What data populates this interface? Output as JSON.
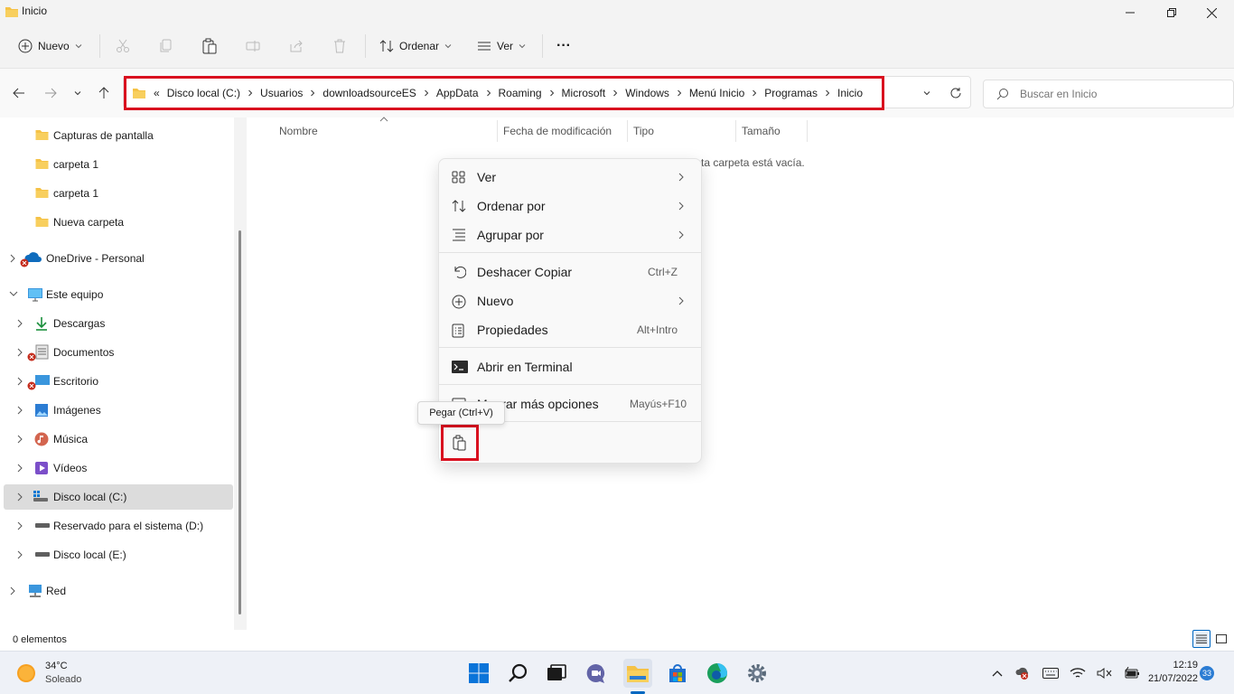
{
  "window": {
    "title": "Inicio"
  },
  "toolbar": {
    "new_label": "Nuevo",
    "sort_label": "Ordenar",
    "view_label": "Ver",
    "more_label": "···"
  },
  "address": {
    "overflow": "«",
    "crumbs": [
      "Disco local (C:)",
      "Usuarios",
      "downloadsourceES",
      "AppData",
      "Roaming",
      "Microsoft",
      "Windows",
      "Menú Inicio",
      "Programas",
      "Inicio"
    ]
  },
  "search": {
    "placeholder": "Buscar en Inicio"
  },
  "sidebar": {
    "items": [
      {
        "label": "Capturas de pantalla"
      },
      {
        "label": "carpeta 1"
      },
      {
        "label": "carpeta 1"
      },
      {
        "label": "Nueva carpeta"
      },
      {
        "label": "OneDrive - Personal"
      },
      {
        "label": "Este equipo"
      },
      {
        "label": "Descargas"
      },
      {
        "label": "Documentos"
      },
      {
        "label": "Escritorio"
      },
      {
        "label": "Imágenes"
      },
      {
        "label": "Música"
      },
      {
        "label": "Vídeos"
      },
      {
        "label": "Disco local (C:)"
      },
      {
        "label": "Reservado para el sistema (D:)"
      },
      {
        "label": "Disco local (E:)"
      },
      {
        "label": "Red"
      }
    ]
  },
  "columns": {
    "name": "Nombre",
    "modified": "Fecha de modificación",
    "type": "Tipo",
    "size": "Tamaño"
  },
  "content": {
    "empty_message": "ta carpeta está vacía."
  },
  "context_menu": {
    "view": "Ver",
    "sort_by": "Ordenar por",
    "group_by": "Agrupar por",
    "undo": "Deshacer Copiar",
    "undo_shortcut": "Ctrl+Z",
    "new": "Nuevo",
    "properties": "Propiedades",
    "properties_shortcut": "Alt+Intro",
    "terminal": "Abrir en Terminal",
    "more_options": "M    rar más opciones",
    "more_shortcut": "Mayús+F10"
  },
  "tooltip": {
    "paste": "Pegar (Ctrl+V)"
  },
  "status": {
    "items_count": "0 elementos"
  },
  "taskbar": {
    "temperature": "34°C",
    "weather": "Soleado",
    "time": "12:19",
    "date": "21/07/2022",
    "notification_count": "33"
  },
  "colors": {
    "highlight": "#d9101f",
    "accent": "#0067c0",
    "folder": "#f5c246"
  }
}
